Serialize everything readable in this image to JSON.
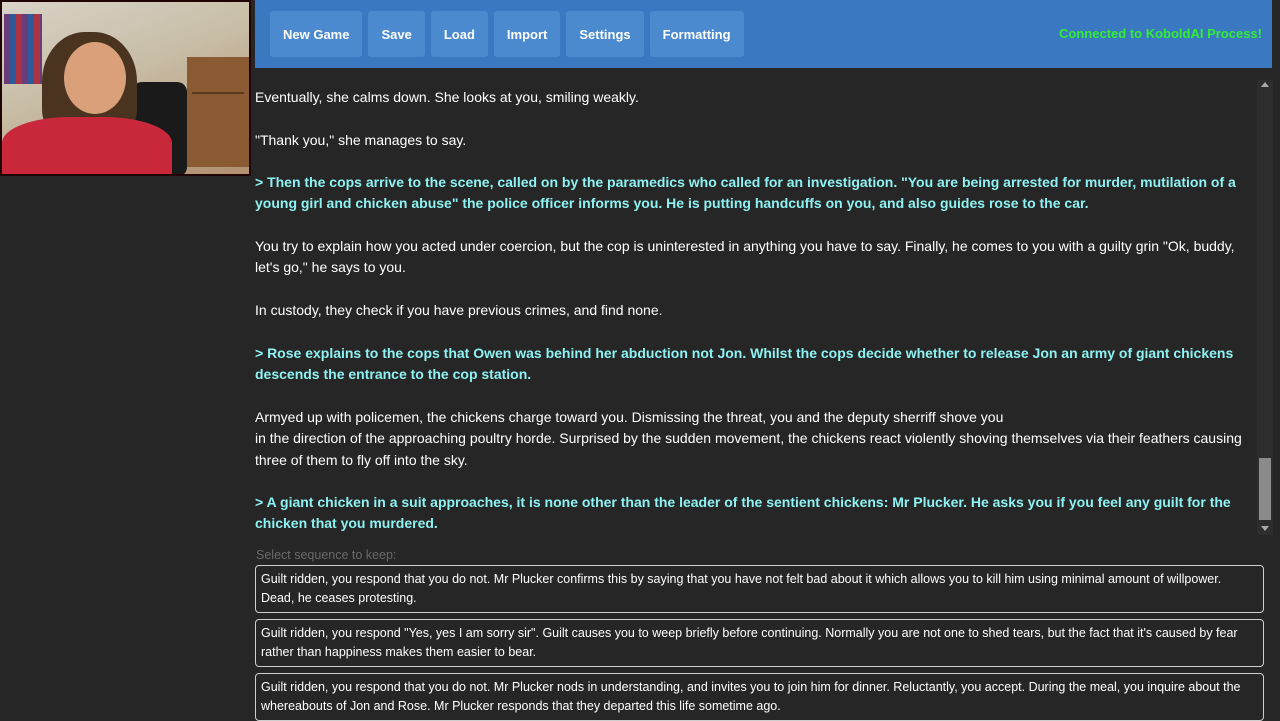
{
  "menu": {
    "new_game": "New Game",
    "save": "Save",
    "load": "Load",
    "import": "Import",
    "settings": "Settings",
    "formatting": "Formatting"
  },
  "status": "Connected to KoboldAI Process!",
  "story": [
    {
      "text": "Eventually, she calms down. She looks at you, smiling weakly.",
      "type": "narration"
    },
    {
      "text": "\"Thank you,\" she manages to say.",
      "type": "narration"
    },
    {
      "text": "> Then the cops arrive to the scene, called on by the paramedics who called for an investigation. \"You are being arrested for murder, mutilation of a young girl and chicken abuse\" the police officer informs you. He is putting handcuffs on you, and also guides rose to the car.",
      "type": "action"
    },
    {
      "text": "You try to explain how you acted under coercion, but the cop is uninterested in anything you have to say. Finally, he comes to you with a guilty grin \"Ok, buddy, let's go,\" he says to you.",
      "type": "narration"
    },
    {
      "text": "In custody, they check if you have previous crimes, and find none.",
      "type": "narration"
    },
    {
      "text": "> Rose explains to the cops that Owen was behind her abduction not Jon. Whilst the cops decide whether to release Jon an army of giant chickens descends the entrance to the cop station.",
      "type": "action"
    },
    {
      "text": "Armyed up with policemen, the chickens charge toward you. Dismissing the threat, you and the deputy sherriff shove you\nin the direction of the approaching poultry horde. Surprised by the sudden movement, the chickens react violently shoving themselves via their feathers causing three of them to fly off into the sky.",
      "type": "narration"
    },
    {
      "text": "> A giant chicken in a suit approaches, it is none other than the leader of the sentient chickens: Mr Plucker. He asks you if you feel any guilt for the chicken that you murdered.",
      "type": "action"
    }
  ],
  "sequence": {
    "label": "Select sequence to keep:",
    "options": [
      "Guilt ridden, you respond that you do not. Mr Plucker confirms this by saying that you have not felt bad about it which allows you to kill him using minimal amount of willpower. Dead, he ceases protesting.",
      "Guilt ridden, you respond \"Yes, yes I am sorry sir\". Guilt causes you to weep briefly before continuing. Normally you are not one to shed tears, but the fact that it's caused by fear rather than happiness makes them easier to bear.",
      "Guilt ridden, you respond that you do not. Mr Plucker nods in understanding, and invites you to join him for dinner. Reluctantly, you accept. During the meal, you inquire about the whereabouts of Jon and Rose. Mr Plucker responds that they departed this life sometime ago."
    ]
  },
  "colors": {
    "topbar": "#3a78c2",
    "button": "#4c8ad0",
    "status": "#33ee33",
    "action_text": "#8ef2f2",
    "background": "#262626"
  },
  "webcam": {
    "description_icon": "webcam-overlay"
  }
}
